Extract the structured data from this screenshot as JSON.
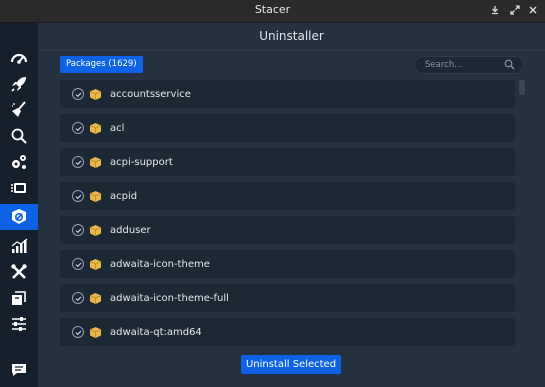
{
  "window": {
    "title": "Stacer",
    "controls": [
      "download-icon",
      "fullscreen-icon",
      "close-icon"
    ]
  },
  "sidebar": {
    "items": [
      {
        "name": "dashboard",
        "icon": "speedometer-icon",
        "active": false
      },
      {
        "name": "startup-apps",
        "icon": "rocket-icon",
        "active": false
      },
      {
        "name": "system-cleaner",
        "icon": "broom-icon",
        "active": false
      },
      {
        "name": "search",
        "icon": "magnifier-icon",
        "active": false
      },
      {
        "name": "services",
        "icon": "gears-icon",
        "active": false
      },
      {
        "name": "processes",
        "icon": "stack-icon",
        "active": false
      },
      {
        "name": "uninstaller",
        "icon": "package-icon",
        "active": true
      },
      {
        "name": "resources",
        "icon": "chart-icon",
        "active": false
      },
      {
        "name": "helpers",
        "icon": "tools-icon",
        "active": false
      },
      {
        "name": "apt-repository",
        "icon": "boxes-icon",
        "active": false
      },
      {
        "name": "settings",
        "icon": "sliders-icon",
        "active": false
      },
      {
        "name": "feedback",
        "icon": "chat-icon",
        "active": false
      }
    ]
  },
  "main": {
    "page_title": "Uninstaller",
    "packages_button": "Packages (1629)",
    "search_placeholder": "Search...",
    "packages": [
      "accountsservice",
      "acl",
      "acpi-support",
      "acpid",
      "adduser",
      "adwaita-icon-theme",
      "adwaita-icon-theme-full",
      "adwaita-qt:amd64"
    ],
    "uninstall_button": "Uninstall Selected"
  },
  "colors": {
    "accent": "#0d62e6",
    "background": "#253140",
    "sidebar": "#16202c",
    "row": "#1d2835",
    "package_icon": "#e7b84a"
  }
}
